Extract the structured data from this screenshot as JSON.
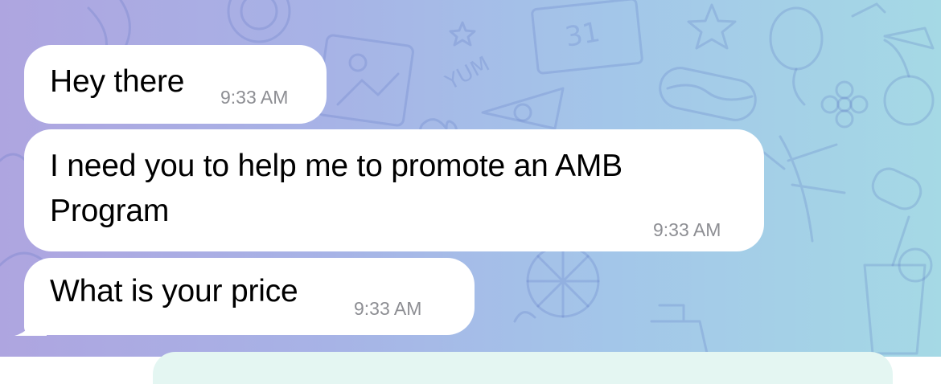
{
  "chat": {
    "messages": [
      {
        "text": "Hey there",
        "time": "9:33 AM"
      },
      {
        "text": "I need you to help me to promote an AMB Program",
        "time": "9:33 AM"
      },
      {
        "text": "What is your price",
        "time": "9:33 AM"
      }
    ]
  },
  "colors": {
    "bubble": "#ffffff",
    "timestamp": "#8d8e93",
    "background_start": "#aea5e0",
    "background_end": "#a5d9e5"
  },
  "icons": [
    "camera-icon",
    "photo-icon",
    "calendar-icon",
    "star-icon",
    "balloon-icon",
    "pizza-icon",
    "hotdog-icon",
    "flower-icon",
    "cherry-icon",
    "palm-leaf-icon",
    "earbuds-icon",
    "drink-icon",
    "citrus-icon",
    "banana-icon",
    "heart-icon",
    "key-icon"
  ],
  "wallpaper": {
    "calendar_number": "31",
    "yum_text": "YUM"
  }
}
